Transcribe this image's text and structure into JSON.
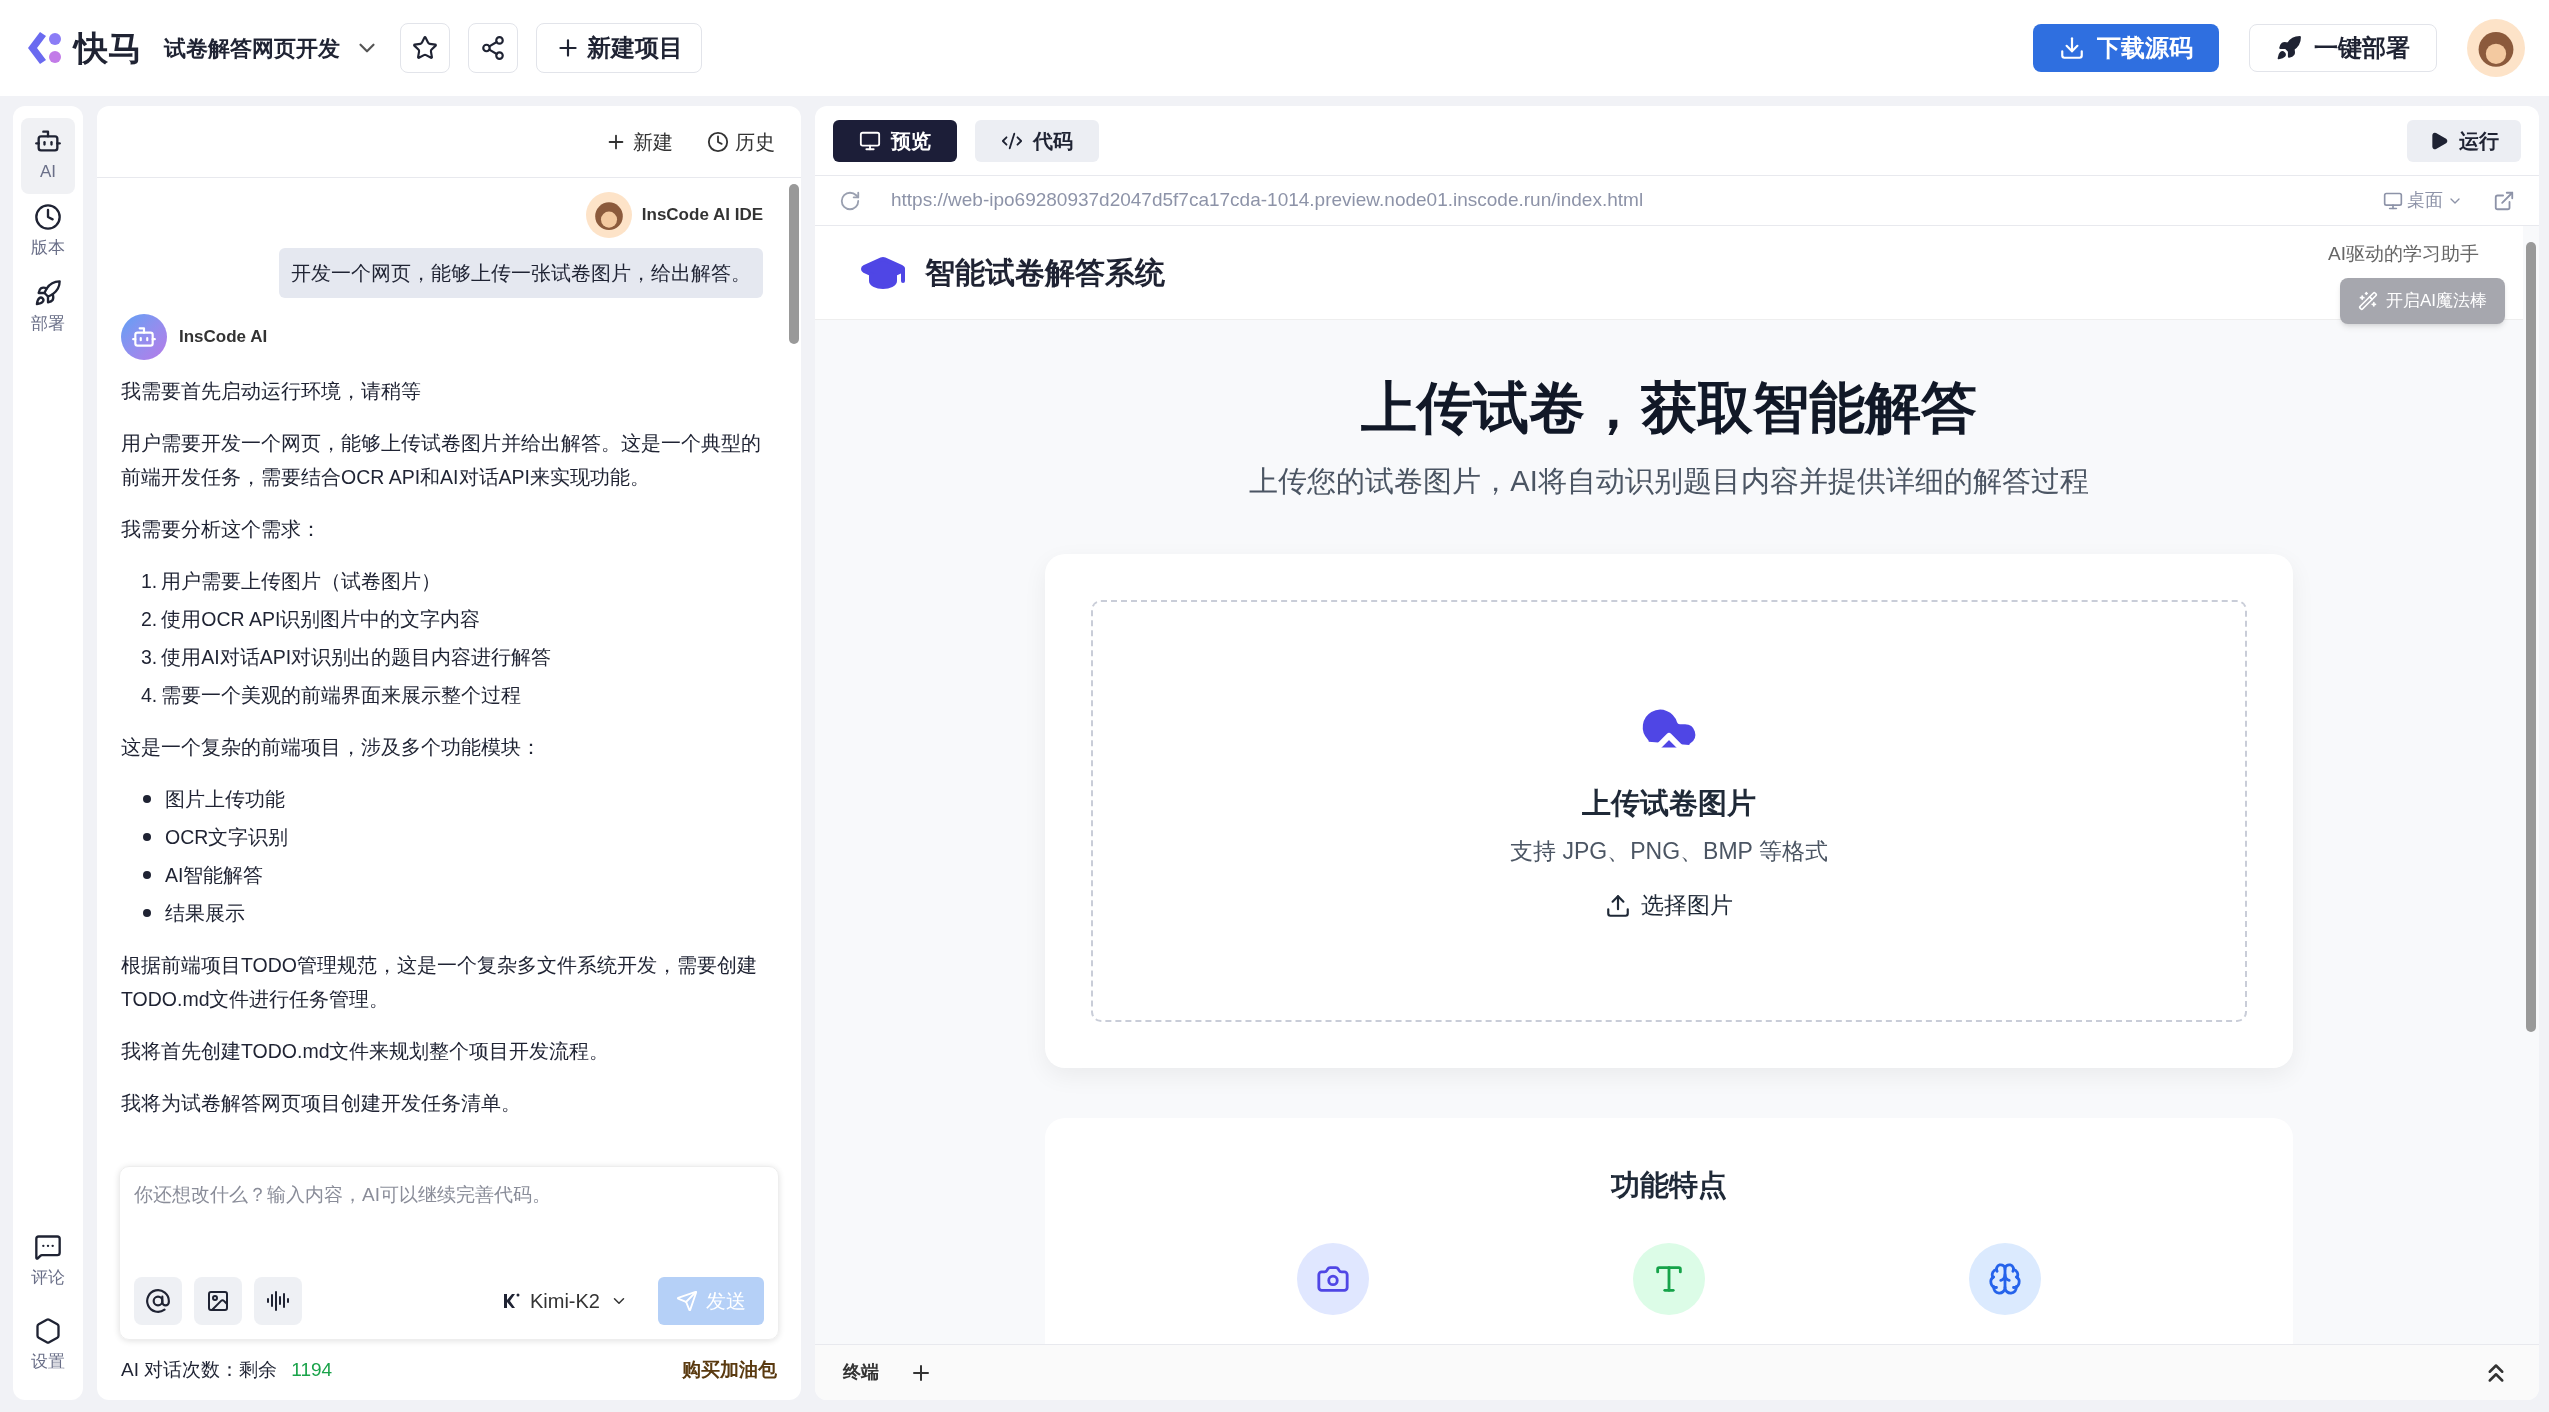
{
  "app": {
    "logo_text": "快马",
    "project": "试卷解答网页开发",
    "new_project": "新建项目",
    "download": "下载源码",
    "deploy": "一键部署"
  },
  "rail": [
    {
      "label": "AI",
      "kind": "robot",
      "selected": true
    },
    {
      "label": "版本",
      "kind": "clock",
      "selected": false
    },
    {
      "label": "部署",
      "kind": "rocket",
      "selected": false
    }
  ],
  "rail_bottom": [
    {
      "label": "评论",
      "kind": "comment"
    },
    {
      "label": "设置",
      "kind": "settings"
    }
  ],
  "chat": {
    "actions": [
      {
        "label": "新建",
        "kind": "plus"
      },
      {
        "label": "历史",
        "kind": "clock"
      }
    ],
    "user_name": "InsCode AI IDE",
    "user_message": "开发一个网页，能够上传一张试卷图片，给出解答。",
    "ai_name": "InsCode AI",
    "blocks": [
      {
        "kind": "p",
        "text": "我需要首先启动运行环境，请稍等"
      },
      {
        "kind": "p",
        "text": "用户需要开发一个网页，能够上传试卷图片并给出解答。这是一个典型的前端开发任务，需要结合OCR API和AI对话API来实现功能。"
      },
      {
        "kind": "p",
        "text": "我需要分析这个需求："
      },
      {
        "kind": "ol",
        "items": [
          {
            "number": "1.",
            "text": "用户需要上传图片（试卷图片）"
          },
          {
            "number": "2.",
            "text": "使用OCR API识别图片中的文字内容"
          },
          {
            "number": "3.",
            "text": "使用AI对话API对识别出的题目内容进行解答"
          },
          {
            "number": "4.",
            "text": "需要一个美观的前端界面来展示整个过程"
          }
        ]
      },
      {
        "kind": "p",
        "text": "这是一个复杂的前端项目，涉及多个功能模块："
      },
      {
        "kind": "ul",
        "items": [
          {
            "text": "图片上传功能"
          },
          {
            "text": "OCR文字识别"
          },
          {
            "text": "AI智能解答"
          },
          {
            "text": "结果展示"
          }
        ]
      },
      {
        "kind": "p",
        "text": "根据前端项目TODO管理规范，这是一个复杂多文件系统开发，需要创建TODO.md文件进行任务管理。"
      },
      {
        "kind": "p",
        "text": "我将首先创建TODO.md文件来规划整个项目开发流程。"
      },
      {
        "kind": "p",
        "text": "我将为试卷解答网页项目创建开发任务清单。"
      }
    ],
    "input": {
      "placeholder": "你还想改什么？输入内容，AI可以继续完善代码。",
      "model": "Kimi-K2",
      "send": "发送",
      "send_disabled": true
    },
    "quota_label": "AI 对话次数：剩余",
    "quota": "1194",
    "buy": "购买加油包"
  },
  "preview": {
    "tabs": [
      {
        "label": "预览",
        "kind": "monitor",
        "selected": true
      },
      {
        "label": "代码",
        "kind": "code",
        "selected": false
      }
    ],
    "run": "运行",
    "url": "https://web-ipo69280937d2047d5f7ca17cda-1014.preview.node01.inscode.run/index.html",
    "device": "桌面",
    "site": {
      "title": "智能试卷解答系统",
      "subtitle": "AI驱动的学习助手",
      "magic": "开启AI魔法棒",
      "hero_title": "上传试卷，获取智能解答",
      "hero_sub": "上传您的试卷图片，AI将自动识别题目内容并提供详细的解答过程",
      "upload_title": "上传试卷图片",
      "upload_formats": "支持 JPG、PNG、BMP 等格式",
      "choose": "选择图片",
      "features_title": "功能特点",
      "features": [
        {
          "kind": "camera",
          "color": "#e0e7ff"
        },
        {
          "kind": "text",
          "color": "#dcfce7"
        },
        {
          "kind": "brain",
          "color": "#dbeafe"
        }
      ]
    },
    "terminal": "终端"
  }
}
